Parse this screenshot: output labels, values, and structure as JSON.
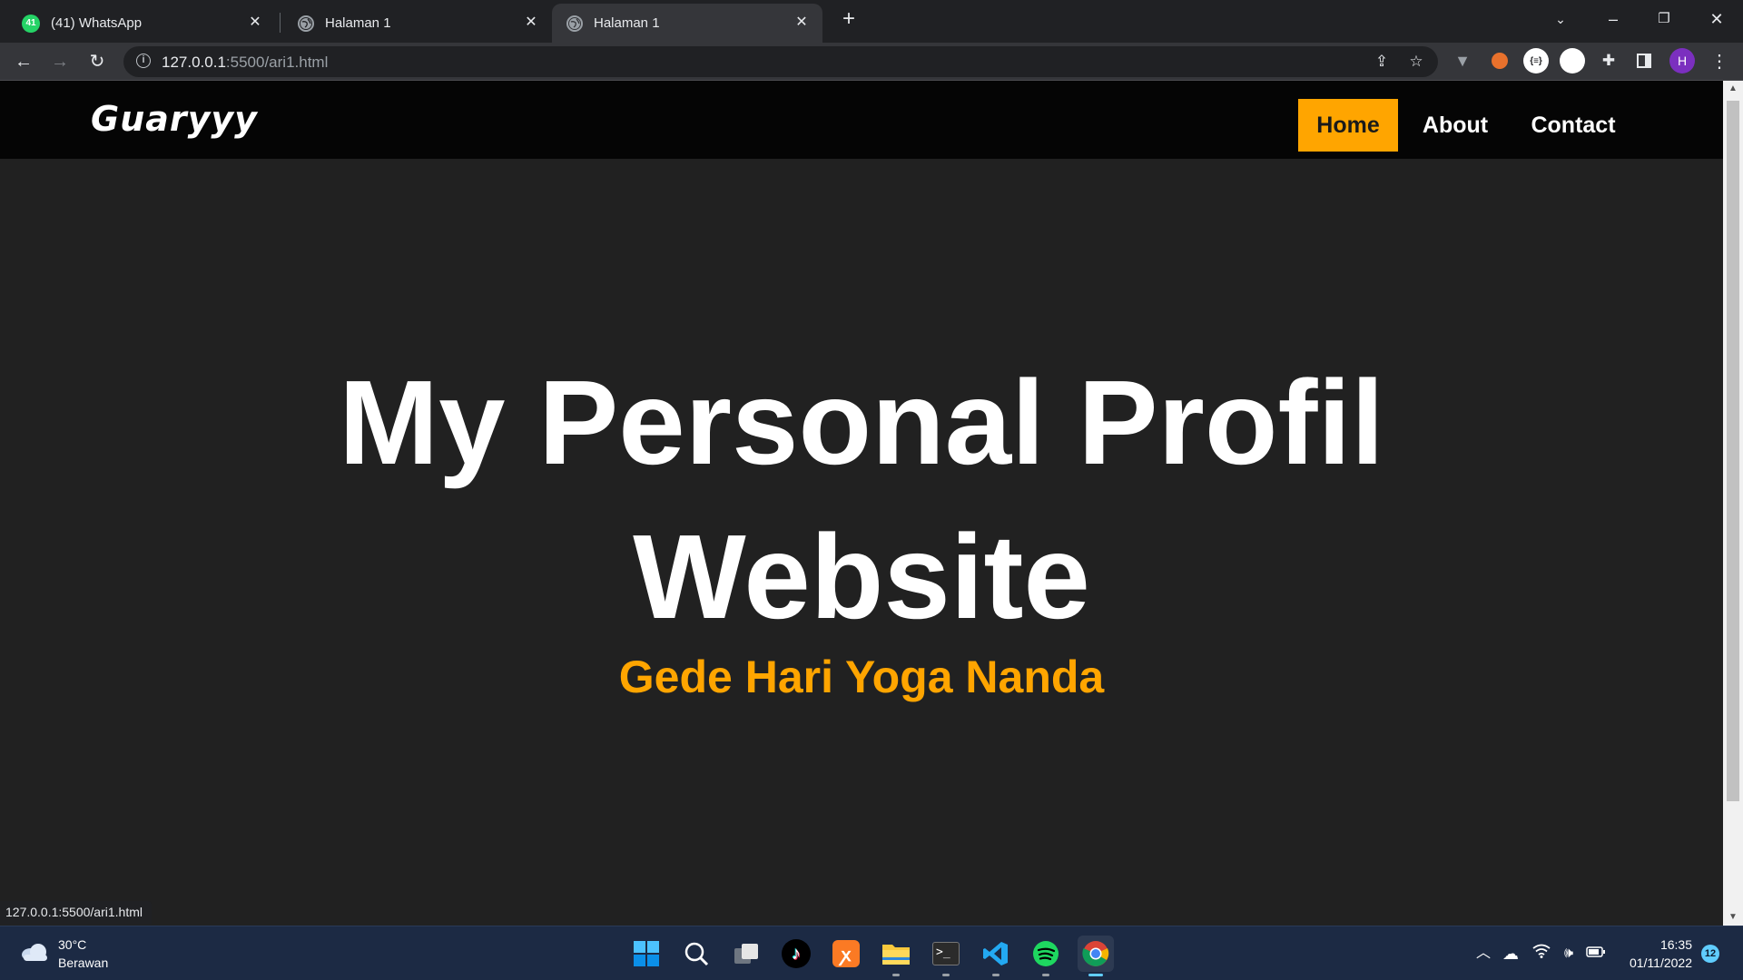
{
  "browser": {
    "tabs": [
      {
        "label": "(41) WhatsApp",
        "badge": "41",
        "icon": "whatsapp-icon"
      },
      {
        "label": "Halaman 1",
        "icon": "globe-icon"
      },
      {
        "label": "Halaman 1",
        "icon": "globe-icon",
        "active": true
      }
    ],
    "new_tab_label": "+",
    "url_host": "127.0.0.1",
    "url_path": ":5500/ari1.html",
    "profile_initial": "H",
    "extension_badge": "{≡}"
  },
  "site": {
    "brand": "Guaryyy",
    "nav": [
      {
        "label": "Home",
        "active": true
      },
      {
        "label": "About"
      },
      {
        "label": "Contact"
      }
    ],
    "hero_line1": "My Personal Profil",
    "hero_line2": "Website",
    "hero_subtitle": "Gede Hari Yoga Nanda",
    "accent_color": "#ffa500"
  },
  "status_bar": {
    "url": "127.0.0.1:5500/ari1.html"
  },
  "taskbar": {
    "weather_temp": "30°C",
    "weather_desc": "Berawan",
    "clock_time": "16:35",
    "clock_date": "01/11/2022",
    "notification_count": "12",
    "apps": [
      "windows-start-icon",
      "search-icon",
      "task-view-icon",
      "tiktok-icon",
      "xampp-icon",
      "file-explorer-icon",
      "terminal-icon",
      "vscode-icon",
      "spotify-icon",
      "chrome-icon"
    ]
  }
}
